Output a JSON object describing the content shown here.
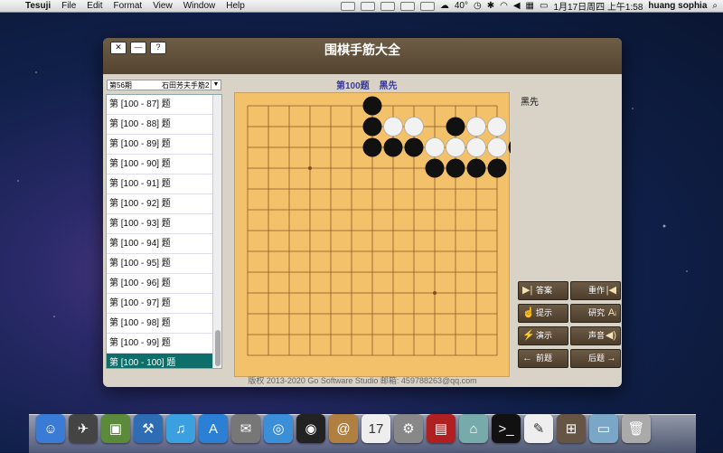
{
  "menubar": {
    "app": "Tesuji",
    "items": [
      "File",
      "Edit",
      "Format",
      "View",
      "Window",
      "Help"
    ],
    "temperature": "40°",
    "datetime": "1月17日周四 上午1:58",
    "user": "huang sophia"
  },
  "window": {
    "title": "围棋手筋大全",
    "buttons": {
      "close": "✕",
      "minimize": "—",
      "help": "?"
    }
  },
  "selector": {
    "volume": "第56期",
    "book": "石田芳夫手筋2"
  },
  "problem_list": [
    "第 [100 - 87] 题",
    "第 [100 - 88] 题",
    "第 [100 - 89] 题",
    "第 [100 - 90] 题",
    "第 [100 - 91] 题",
    "第 [100 - 92] 题",
    "第 [100 - 93] 题",
    "第 [100 - 94] 题",
    "第 [100 - 95] 题",
    "第 [100 - 96] 题",
    "第 [100 - 97] 题",
    "第 [100 - 98] 题",
    "第 [100 - 99] 题",
    "第 [100 - 100] 题"
  ],
  "selected_index": 13,
  "problem": {
    "number": "第100题",
    "to_play": "黑先"
  },
  "side_label": "黑先",
  "board": {
    "black": [
      [
        6,
        0
      ],
      [
        6,
        1
      ],
      [
        10,
        1
      ],
      [
        6,
        2
      ],
      [
        7,
        2
      ],
      [
        8,
        2
      ],
      [
        13,
        2
      ],
      [
        9,
        3
      ],
      [
        10,
        3
      ],
      [
        11,
        3
      ],
      [
        12,
        3
      ]
    ],
    "white": [
      [
        7,
        1
      ],
      [
        8,
        1
      ],
      [
        11,
        1
      ],
      [
        12,
        1
      ],
      [
        9,
        2
      ],
      [
        10,
        2
      ],
      [
        11,
        2
      ],
      [
        12,
        2
      ]
    ],
    "star_points": [
      [
        3,
        3
      ],
      [
        9,
        9
      ]
    ]
  },
  "buttons": {
    "answer": "答案",
    "redo": "重作",
    "hint": "提示",
    "study": "研究",
    "demo": "演示",
    "sound": "声音",
    "prev": "前题",
    "next": "后题"
  },
  "footer": "版权 2013-2020 Go Software Studio    邮箱: 459788263@qq.com",
  "dock": [
    "finder-icon",
    "rocket-icon",
    "preview-icon",
    "xcode-icon",
    "itunes-icon",
    "appstore-icon",
    "mail-icon",
    "safari-icon",
    "facetime-icon",
    "contacts-icon",
    "calendar-icon",
    "system-preferences-icon",
    "photobooth-icon",
    "network-icon",
    "terminal-icon",
    "textedit-icon",
    "tesuji-icon",
    "folder-icon",
    "trash-icon"
  ]
}
